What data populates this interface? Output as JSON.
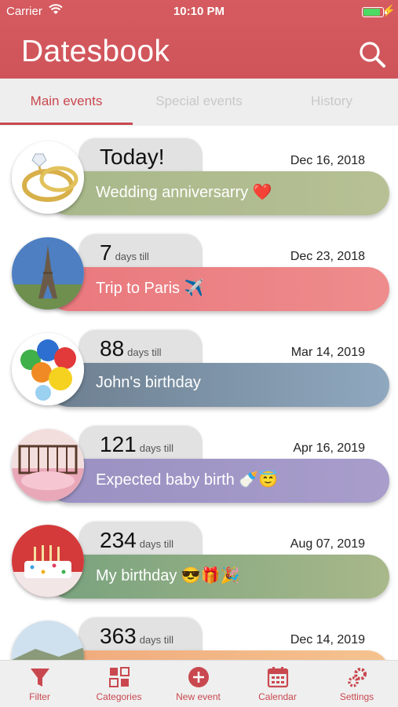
{
  "status_bar": {
    "carrier": "Carrier",
    "time": "10:10 PM",
    "battery_level": 0.9
  },
  "header": {
    "title": "Datesbook",
    "search_icon": "search-icon"
  },
  "tabs": [
    {
      "label": "Main events",
      "active": true
    },
    {
      "label": "Special events",
      "active": false
    },
    {
      "label": "History",
      "active": false
    }
  ],
  "events": [
    {
      "today_label": "Today!",
      "date": "Dec 16, 2018",
      "title": "Wedding anniversarry ❤️",
      "bar_from": "#a8b88a",
      "bar_to": "#b6c094",
      "image": "wedding-rings"
    },
    {
      "count": "7",
      "count_label": "days till",
      "date": "Dec 23, 2018",
      "title": "Trip to Paris ✈️",
      "bar_from": "#e9787d",
      "bar_to": "#ee8c8c",
      "image": "eiffel-tower"
    },
    {
      "count": "88",
      "count_label": "days till",
      "date": "Mar 14, 2019",
      "title": "John's birthday",
      "bar_from": "#6d7f90",
      "bar_to": "#8fa8bf",
      "image": "balloons"
    },
    {
      "count": "121",
      "count_label": "days till",
      "date": "Apr 16, 2019",
      "title": "Expected baby birth 🍼😇",
      "bar_from": "#9a91c2",
      "bar_to": "#a89dcb",
      "image": "baby-crib"
    },
    {
      "count": "234",
      "count_label": "days till",
      "date": "Aug 07, 2019",
      "title": "My birthday 😎🎁🎉",
      "bar_from": "#78a27e",
      "bar_to": "#a8b88a",
      "image": "birthday-cake"
    },
    {
      "count": "363",
      "count_label": "days till",
      "date": "Dec 14, 2019",
      "title": "",
      "bar_from": "#f0a97c",
      "bar_to": "#f5c38f",
      "image": "landscape"
    }
  ],
  "toolbar": [
    {
      "label": "Filter",
      "icon": "filter-icon"
    },
    {
      "label": "Categories",
      "icon": "categories-icon"
    },
    {
      "label": "New event",
      "icon": "plus-circle-icon"
    },
    {
      "label": "Calendar",
      "icon": "calendar-icon"
    },
    {
      "label": "Settings",
      "icon": "gear-icon"
    }
  ]
}
